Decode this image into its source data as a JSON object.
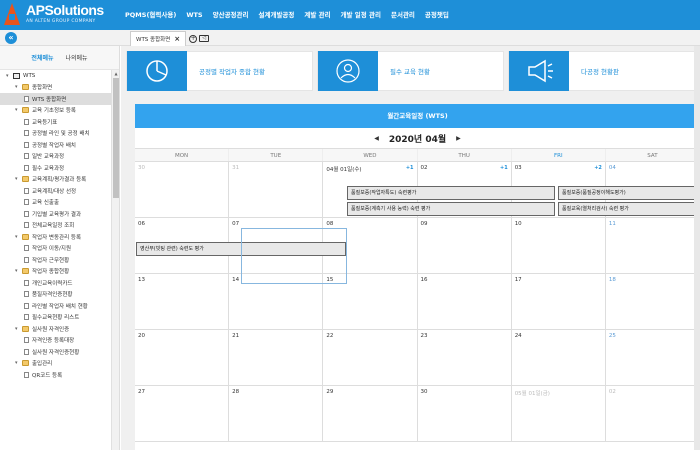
{
  "brand": {
    "name": "APSolutions",
    "sub": "AN ALTEN GROUP COMPANY"
  },
  "menu": [
    "PQMS(협력사용)",
    "WTS",
    "양산공정관리",
    "설계개발공정",
    "계발 관리",
    "개발 일정 관리",
    "문서관리",
    "공정챗딥"
  ],
  "tab": {
    "label": "WTS 종합화면",
    "close": "×",
    "add": "+",
    "ctrl": "◁"
  },
  "sidebar": {
    "tabs": [
      "전체메뉴",
      "나의메뉴"
    ],
    "items": [
      {
        "label": "WTS",
        "level": 0,
        "icon": "screen"
      },
      {
        "label": "종합화면",
        "level": 1,
        "icon": "folder"
      },
      {
        "label": "WTS 종합화면",
        "level": 2,
        "icon": "page",
        "selected": true
      },
      {
        "label": "교육 기초정보 등록",
        "level": 1,
        "icon": "folder"
      },
      {
        "label": "교육등기표",
        "level": 2,
        "icon": "page"
      },
      {
        "label": "공정별 라인 및 공정 배치",
        "level": 2,
        "icon": "page"
      },
      {
        "label": "공정별 작업자 배치",
        "level": 2,
        "icon": "page"
      },
      {
        "label": "일반 교육과정",
        "level": 2,
        "icon": "page"
      },
      {
        "label": "필수 교육과정",
        "level": 2,
        "icon": "page"
      },
      {
        "label": "교육계획/평가결과 등록",
        "level": 1,
        "icon": "folder"
      },
      {
        "label": "교육계획/대상 선정",
        "level": 2,
        "icon": "page"
      },
      {
        "label": "교육 신출출",
        "level": 2,
        "icon": "page"
      },
      {
        "label": "기입별 교육평가 결과",
        "level": 2,
        "icon": "page"
      },
      {
        "label": "전체교육일정 조회",
        "level": 2,
        "icon": "page"
      },
      {
        "label": "작업자 변동관리 등록",
        "level": 1,
        "icon": "folder"
      },
      {
        "label": "작업자 이동/지원",
        "level": 2,
        "icon": "page"
      },
      {
        "label": "작업자 근무현황",
        "level": 2,
        "icon": "page"
      },
      {
        "label": "작업자 종합현황",
        "level": 1,
        "icon": "folder"
      },
      {
        "label": "개인교육이력카드",
        "level": 2,
        "icon": "page"
      },
      {
        "label": "품질자격인증현황",
        "level": 2,
        "icon": "page"
      },
      {
        "label": "라인별 작업자 배치 현황",
        "level": 2,
        "icon": "page"
      },
      {
        "label": "필수교육현황 리스트",
        "level": 2,
        "icon": "page"
      },
      {
        "label": "실사원 자격인증",
        "level": 1,
        "icon": "folder"
      },
      {
        "label": "자격인증 등록대장",
        "level": 2,
        "icon": "page"
      },
      {
        "label": "실사원 자격인증현황",
        "level": 2,
        "icon": "page"
      },
      {
        "label": "출입관리",
        "level": 1,
        "icon": "folder"
      },
      {
        "label": "QR코드 등록",
        "level": 2,
        "icon": "page"
      }
    ]
  },
  "cards": [
    {
      "label": "공정별 작업자 종합 현황",
      "icon": "pie-chart-icon"
    },
    {
      "label": "필수 교육 현황",
      "icon": "person-icon"
    },
    {
      "label": "다공정 현황판",
      "icon": "megaphone-icon"
    }
  ],
  "calendar": {
    "title": "월간교육일정 (WTS)",
    "month": "2020년 04월",
    "prev": "◀",
    "next": "▶",
    "days": [
      "MON",
      "TUE",
      "WED",
      "THU",
      "FRI",
      "SAT"
    ],
    "weeks": [
      [
        {
          "d": "30",
          "muted": true
        },
        {
          "d": "31",
          "muted": true
        },
        {
          "d": "04월 01일(수)",
          "more": "+1"
        },
        {
          "d": "02",
          "more": "+1"
        },
        {
          "d": "03",
          "more": "+2"
        },
        {
          "d": "04",
          "blue": true
        }
      ],
      [
        {
          "d": "06"
        },
        {
          "d": "07"
        },
        {
          "d": "08"
        },
        {
          "d": "09"
        },
        {
          "d": "10"
        },
        {
          "d": "11",
          "blue": true
        }
      ],
      [
        {
          "d": "13"
        },
        {
          "d": "14"
        },
        {
          "d": "15"
        },
        {
          "d": "16"
        },
        {
          "d": "17"
        },
        {
          "d": "18",
          "blue": true
        }
      ],
      [
        {
          "d": "20"
        },
        {
          "d": "21"
        },
        {
          "d": "22"
        },
        {
          "d": "23"
        },
        {
          "d": "24"
        },
        {
          "d": "25",
          "blue": true
        }
      ],
      [
        {
          "d": "27"
        },
        {
          "d": "28"
        },
        {
          "d": "29"
        },
        {
          "d": "30"
        },
        {
          "d": "05월 01일(금)",
          "muted": true
        },
        {
          "d": "02",
          "muted": true
        }
      ]
    ],
    "events": {
      "e1": "품질보증(작업자특도) 숙련평가",
      "e2": "품질보증(계측기 사용 능력) 숙련 평가",
      "e3": "품질보증(품질공정이해도평가)",
      "e4": "품질교육(열처리검사) 숙련 평가",
      "e5": "영산부(빗팅 관련) 숙련도 평가"
    }
  }
}
